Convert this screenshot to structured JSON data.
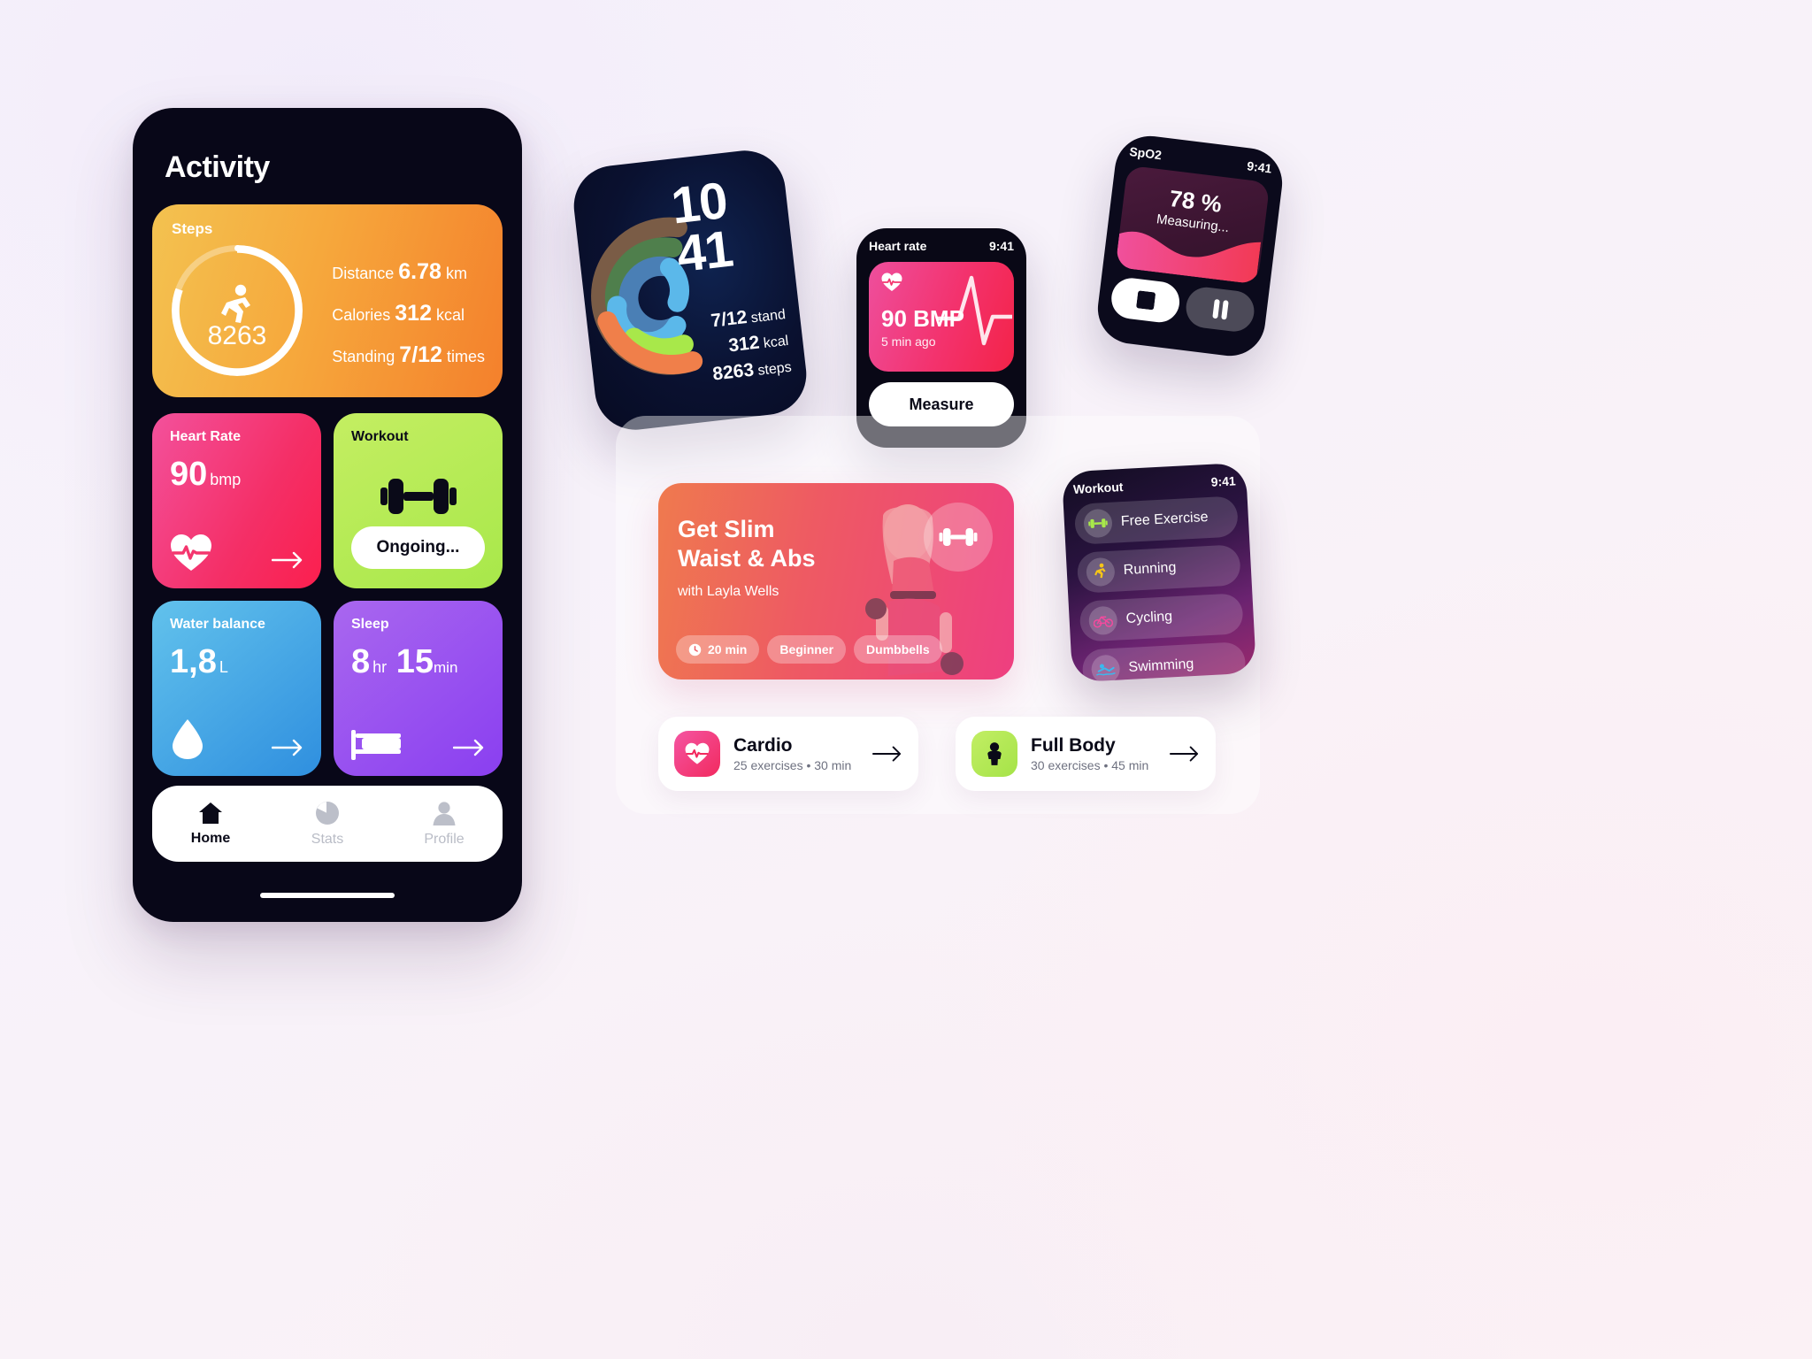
{
  "phone": {
    "title": "Activity",
    "steps_card": {
      "label": "Steps",
      "value": "8263",
      "progress_pct": 80,
      "runner_icon": "runner-icon",
      "stats": [
        {
          "label": "Distance",
          "value": "6.78",
          "unit": "km"
        },
        {
          "label": "Calories",
          "value": "312",
          "unit": "kcal"
        },
        {
          "label": "Standing",
          "value": "7/12",
          "unit": "times"
        }
      ]
    },
    "tiles": [
      {
        "title": "Heart Rate",
        "value": "90",
        "unit": "bmp",
        "icon": "heart-pulse-icon",
        "arrow": "→",
        "color": "#f42f67"
      },
      {
        "title": "Workout",
        "button": "Ongoing...",
        "icon": "dumbbell-icon",
        "color": "#a8e84a"
      },
      {
        "title": "Water balance",
        "value": "1,8",
        "unit": "L",
        "icon": "water-drop-icon",
        "arrow": "→",
        "color": "#2f8fdf"
      },
      {
        "title": "Sleep",
        "value": "8",
        "unit": "hr",
        "value2": "15",
        "unit2": "min",
        "icon": "bed-icon",
        "arrow": "→",
        "color": "#8a3ff0"
      }
    ],
    "tabs": [
      {
        "label": "Home",
        "icon": "home-icon",
        "active": true
      },
      {
        "label": "Stats",
        "icon": "pie-chart-icon",
        "active": false
      },
      {
        "label": "Profile",
        "icon": "person-icon",
        "active": false
      }
    ]
  },
  "watch_rings": {
    "hour": "10",
    "minute": "41",
    "stats": [
      {
        "value": "7/12",
        "label": "stand"
      },
      {
        "value": "312",
        "label": "kcal"
      },
      {
        "value": "8263",
        "label": "steps"
      }
    ],
    "ring_colors": [
      "#f07f4a",
      "#a8e84a",
      "#5bb8ea",
      "#4a7fb5",
      "#4f7f4c",
      "#7a5c46"
    ]
  },
  "watch_heart_rate": {
    "title": "Heart rate",
    "time": "9:41",
    "value": "90 BMP",
    "subtitle": "5 min ago",
    "button": "Measure",
    "icon": "heart-pulse-icon",
    "accent": "#f3326d"
  },
  "watch_spo2": {
    "title": "SpO2",
    "time": "9:41",
    "value": "78 %",
    "status": "Measuring...",
    "stop_icon": "stop-icon",
    "pause_icon": "pause-icon",
    "accent": "#ee3f80"
  },
  "promo": {
    "title_line1": "Get Slim",
    "title_line2": "Waist & Abs",
    "subtitle": "with Layla Wells",
    "badge_icon": "dumbbell-icon",
    "chips": [
      {
        "label": "20 min",
        "icon": "clock-icon"
      },
      {
        "label": "Beginner",
        "icon": ""
      },
      {
        "label": "Dumbbells",
        "icon": ""
      }
    ]
  },
  "watch_workout_list": {
    "title": "Workout",
    "time": "9:41",
    "items": [
      {
        "label": "Free Exercise",
        "icon": "dumbbell-icon",
        "color": "#a8e84a"
      },
      {
        "label": "Running",
        "icon": "runner-icon",
        "color": "#f5c518"
      },
      {
        "label": "Cycling",
        "icon": "bicycle-icon",
        "color": "#f34a9e"
      },
      {
        "label": "Swimming",
        "icon": "swimmer-icon",
        "color": "#3bb8ee"
      }
    ]
  },
  "workout_rows": [
    {
      "title": "Cardio",
      "subtitle": "25 exercises • 30 min",
      "icon": "heart-pulse-icon",
      "arrow": "→"
    },
    {
      "title": "Full Body",
      "subtitle": "30 exercises • 45 min",
      "icon": "person-icon",
      "arrow": "→"
    }
  ]
}
